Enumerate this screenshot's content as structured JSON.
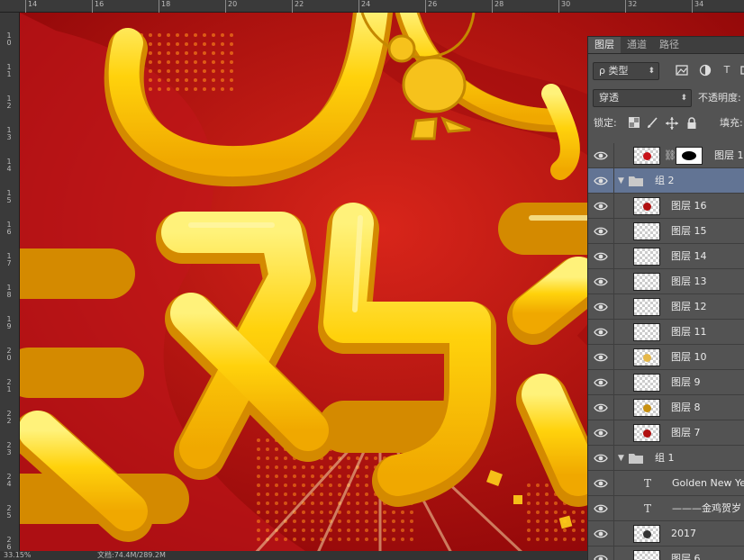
{
  "ruler": {
    "top_labels": [
      "14",
      "16",
      "18",
      "20",
      "22",
      "24",
      "26",
      "28",
      "30",
      "32",
      "34"
    ],
    "left_labels": [
      "1\n0",
      "1\n1",
      "1\n2",
      "1\n3",
      "1\n4",
      "1\n5",
      "1\n6",
      "1\n7",
      "1\n8",
      "1\n9",
      "2\n0",
      "2\n1",
      "2\n2",
      "2\n3",
      "2\n4",
      "2\n5",
      "2\n6"
    ]
  },
  "status": {
    "zoom": "33.15%",
    "doc": "文档:74.4M/289.2M"
  },
  "panel": {
    "tabs": [
      "图层",
      "通道",
      "路径"
    ],
    "filter_kind": "ρ 类型",
    "blend_mode": "穿透",
    "opacity_label": "不透明度:",
    "lock_label": "锁定:",
    "fill_label": "填充:",
    "filter_icons": [
      "image-filter-icon",
      "adjustment-filter-icon",
      "type-filter-icon"
    ],
    "type_filter_glyph": "T"
  },
  "layers": [
    {
      "kind": "layer-mask",
      "name": "图层 1",
      "thumb_color": "#c8141a",
      "visible": true
    },
    {
      "kind": "group",
      "name": "组 2",
      "selected": true,
      "visible": true
    },
    {
      "kind": "pixel",
      "name": "图层 16",
      "thumb_color": "#b01010",
      "visible": true
    },
    {
      "kind": "pixel",
      "name": "图层 15",
      "thumb_color": "",
      "visible": true
    },
    {
      "kind": "pixel",
      "name": "图层 14",
      "thumb_color": "",
      "visible": true
    },
    {
      "kind": "pixel",
      "name": "图层 13",
      "thumb_color": "",
      "visible": true
    },
    {
      "kind": "pixel",
      "name": "图层 12",
      "thumb_color": "",
      "visible": true
    },
    {
      "kind": "pixel",
      "name": "图层 11",
      "thumb_color": "",
      "visible": true
    },
    {
      "kind": "pixel",
      "name": "图层 10",
      "thumb_color": "#e6b84a",
      "visible": true
    },
    {
      "kind": "pixel",
      "name": "图层 9",
      "thumb_color": "",
      "visible": true
    },
    {
      "kind": "pixel",
      "name": "图层 8",
      "thumb_color": "#c89010",
      "visible": true
    },
    {
      "kind": "pixel",
      "name": "图层 7",
      "thumb_color": "#b01010",
      "visible": true
    },
    {
      "kind": "group",
      "name": "组 1",
      "selected": false,
      "visible": true
    },
    {
      "kind": "text",
      "name": "Golden New Yea",
      "visible": true
    },
    {
      "kind": "text",
      "name": "———金鸡贺岁",
      "visible": true
    },
    {
      "kind": "pixel",
      "name": "2017",
      "thumb_color": "#333333",
      "visible": true
    },
    {
      "kind": "pixel",
      "name": "图层 6",
      "thumb_color": "",
      "visible": true
    }
  ],
  "canvas": {
    "headline_glyphs": [
      "金",
      "鸡",
      "贺"
    ],
    "colors": {
      "background": "#b80e10",
      "gold": "#ffd21a",
      "gold_dark": "#d48a00"
    }
  }
}
